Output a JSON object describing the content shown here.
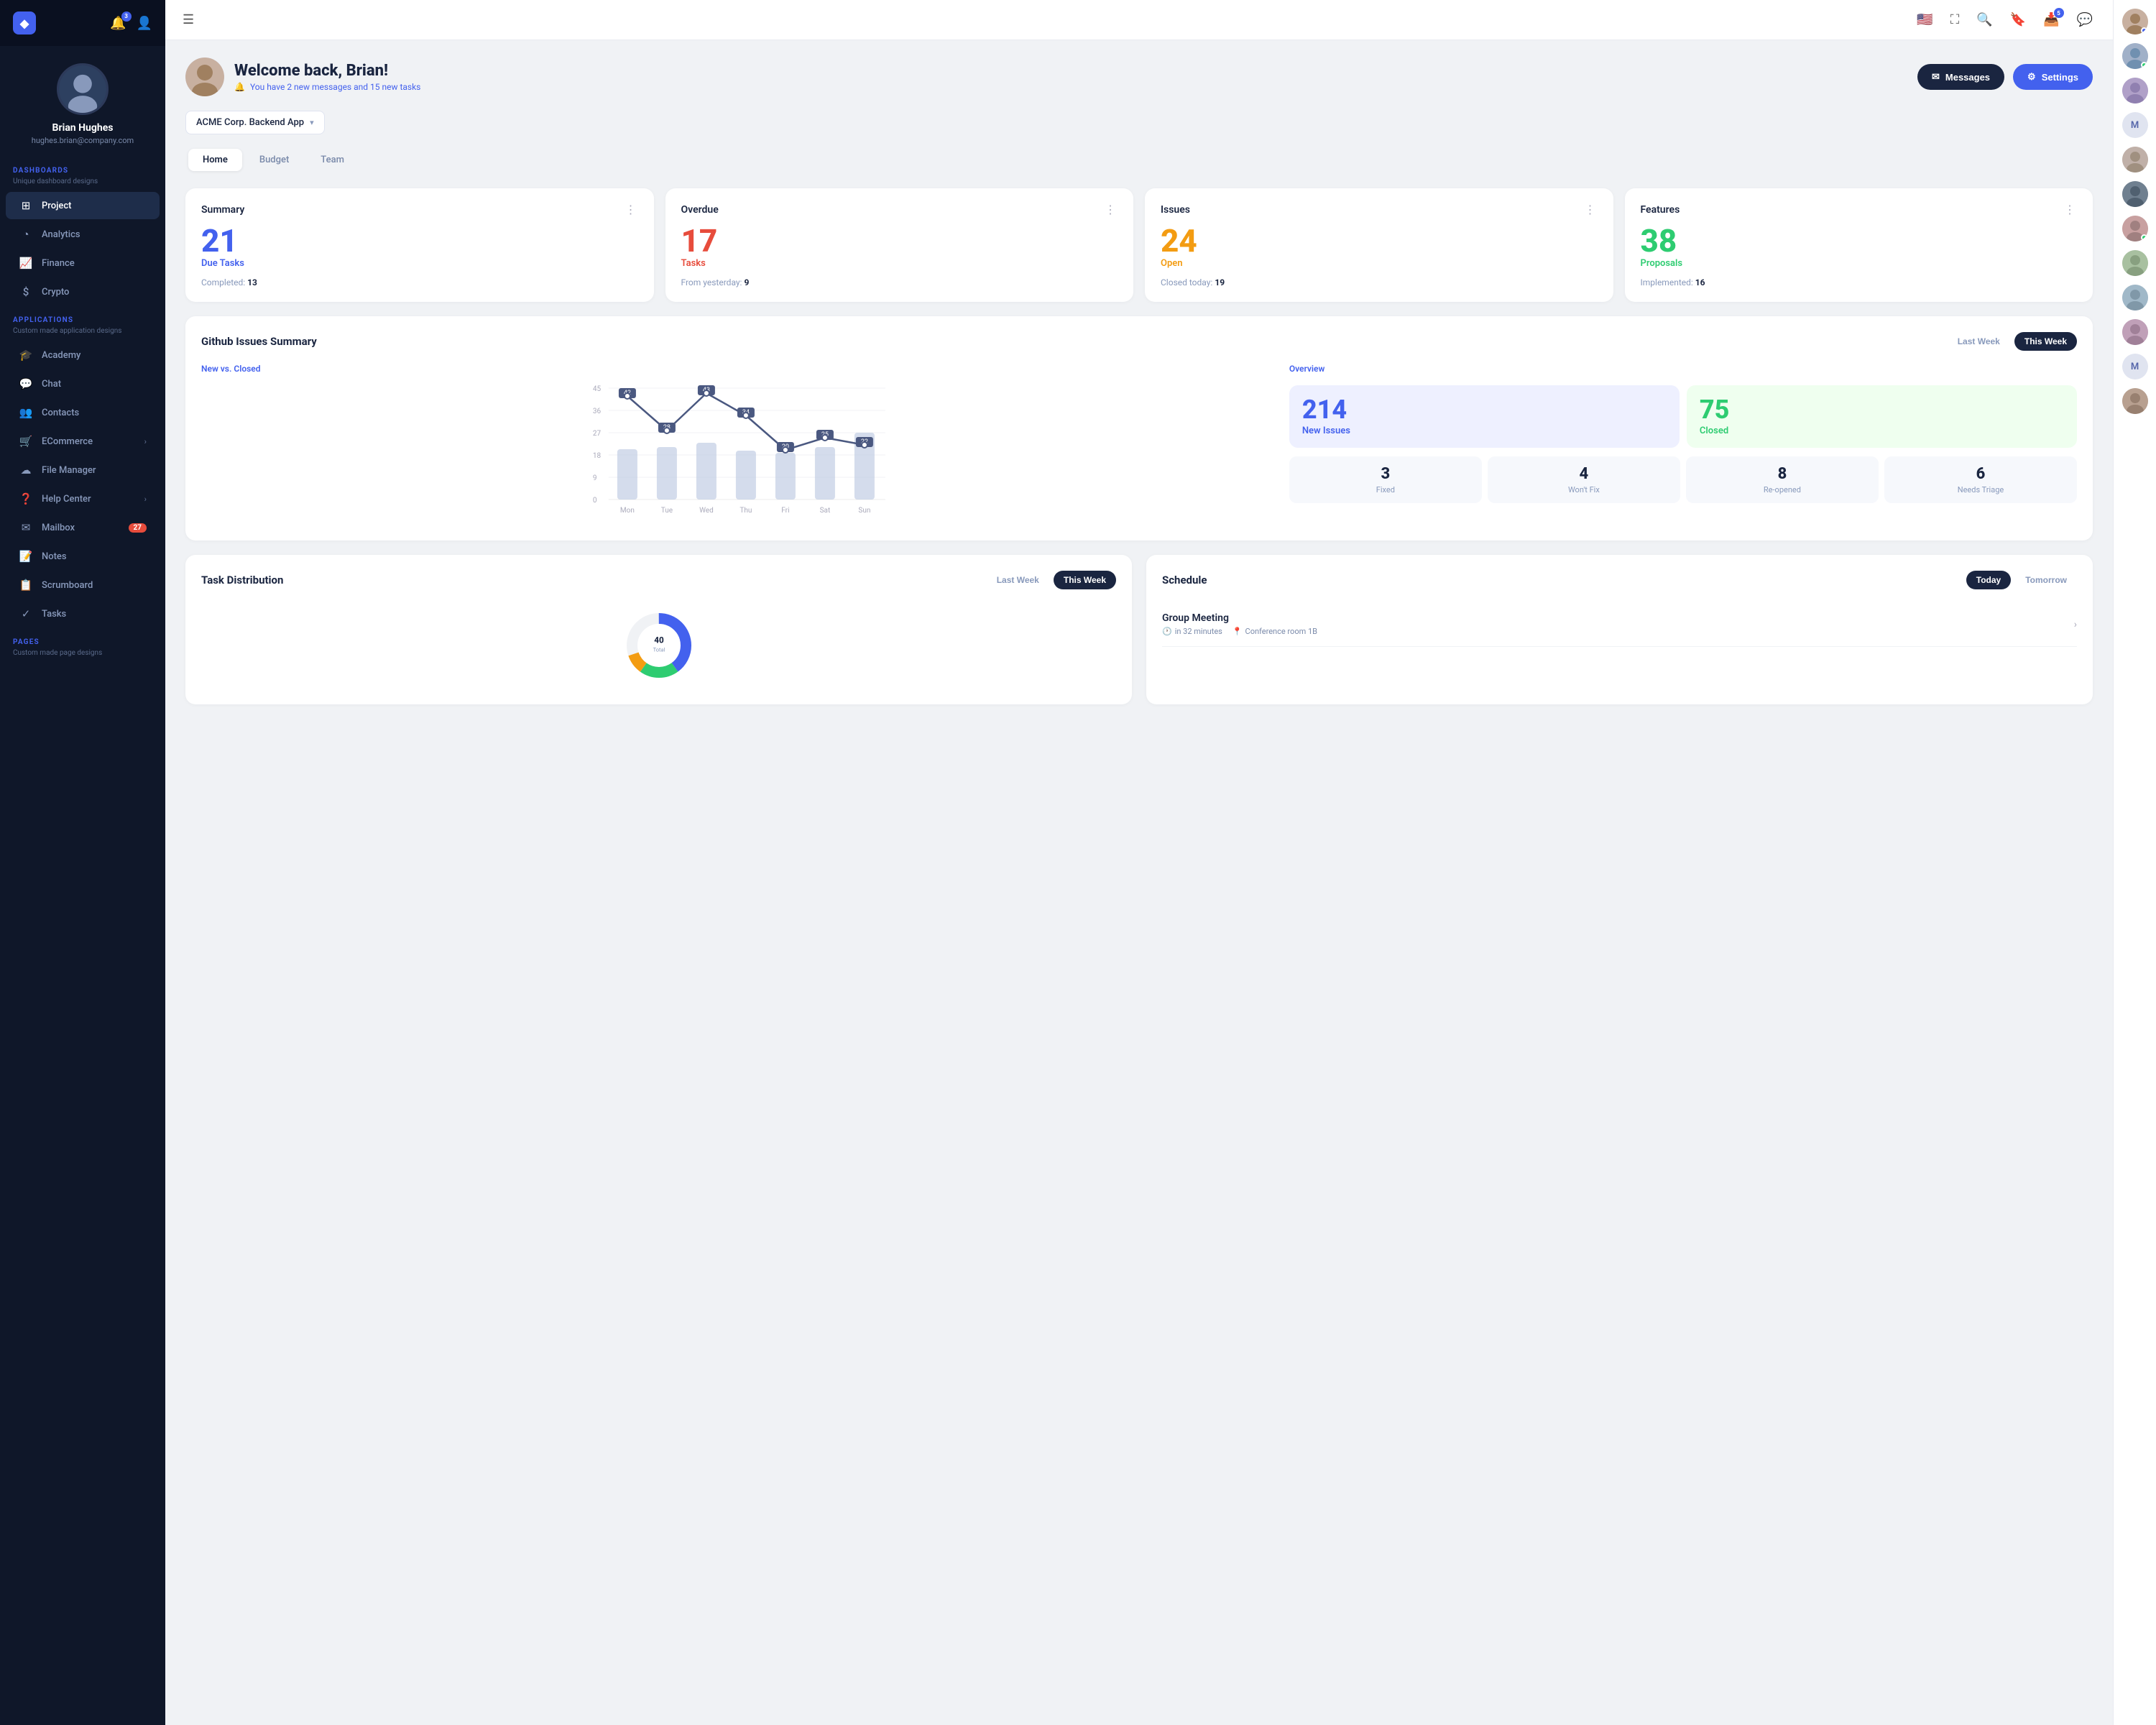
{
  "app": {
    "logo": "◆",
    "notifications_count": "3"
  },
  "sidebar": {
    "profile": {
      "name": "Brian Hughes",
      "email": "hughes.brian@company.com"
    },
    "dashboards_label": "DASHBOARDS",
    "dashboards_sub": "Unique dashboard designs",
    "applications_label": "APPLICATIONS",
    "applications_sub": "Custom made application designs",
    "pages_label": "PAGES",
    "pages_sub": "Custom made page designs",
    "items": [
      {
        "id": "project",
        "label": "Project",
        "icon": "🗂",
        "active": true
      },
      {
        "id": "analytics",
        "label": "Analytics",
        "icon": "📊"
      },
      {
        "id": "finance",
        "label": "Finance",
        "icon": "📈"
      },
      {
        "id": "crypto",
        "label": "Crypto",
        "icon": "💰"
      },
      {
        "id": "academy",
        "label": "Academy",
        "icon": "🎓"
      },
      {
        "id": "chat",
        "label": "Chat",
        "icon": "💬"
      },
      {
        "id": "contacts",
        "label": "Contacts",
        "icon": "👥"
      },
      {
        "id": "ecommerce",
        "label": "ECommerce",
        "icon": "🛒",
        "arrow": "›"
      },
      {
        "id": "file-manager",
        "label": "File Manager",
        "icon": "☁"
      },
      {
        "id": "help-center",
        "label": "Help Center",
        "icon": "❓",
        "arrow": "›"
      },
      {
        "id": "mailbox",
        "label": "Mailbox",
        "icon": "✉",
        "badge": "27"
      },
      {
        "id": "notes",
        "label": "Notes",
        "icon": "📝"
      },
      {
        "id": "scrumboard",
        "label": "Scrumboard",
        "icon": "📋"
      },
      {
        "id": "tasks",
        "label": "Tasks",
        "icon": "✓"
      }
    ]
  },
  "topbar": {
    "inbox_count": "5"
  },
  "welcome": {
    "title": "Welcome back, Brian!",
    "subtitle": "You have 2 new messages and 15 new tasks",
    "messages_btn": "Messages",
    "settings_btn": "Settings"
  },
  "project_selector": {
    "label": "ACME Corp. Backend App"
  },
  "tabs": [
    {
      "id": "home",
      "label": "Home",
      "active": true
    },
    {
      "id": "budget",
      "label": "Budget"
    },
    {
      "id": "team",
      "label": "Team"
    }
  ],
  "summary_cards": [
    {
      "title": "Summary",
      "number": "21",
      "number_color": "blue",
      "label": "Due Tasks",
      "sub_prefix": "Completed:",
      "sub_value": "13"
    },
    {
      "title": "Overdue",
      "number": "17",
      "number_color": "red",
      "label": "Tasks",
      "sub_prefix": "From yesterday:",
      "sub_value": "9"
    },
    {
      "title": "Issues",
      "number": "24",
      "number_color": "orange",
      "label": "Open",
      "sub_prefix": "Closed today:",
      "sub_value": "19"
    },
    {
      "title": "Features",
      "number": "38",
      "number_color": "green",
      "label": "Proposals",
      "sub_prefix": "Implemented:",
      "sub_value": "16"
    }
  ],
  "github": {
    "title": "Github Issues Summary",
    "last_week_btn": "Last Week",
    "this_week_btn": "This Week",
    "chart_label": "New vs. Closed",
    "overview_label": "Overview",
    "days": [
      "Mon",
      "Tue",
      "Wed",
      "Thu",
      "Fri",
      "Sat",
      "Sun"
    ],
    "line_values": [
      42,
      28,
      43,
      34,
      20,
      25,
      22
    ],
    "bar_heights": [
      70,
      65,
      80,
      60,
      55,
      65,
      90
    ],
    "new_issues": "214",
    "new_issues_label": "New Issues",
    "closed": "75",
    "closed_label": "Closed",
    "mini_stats": [
      {
        "num": "3",
        "label": "Fixed"
      },
      {
        "num": "4",
        "label": "Won't Fix"
      },
      {
        "num": "8",
        "label": "Re-opened"
      },
      {
        "num": "6",
        "label": "Needs Triage"
      }
    ]
  },
  "task_dist": {
    "title": "Task Distribution",
    "last_week_btn": "Last Week",
    "this_week_btn": "This Week"
  },
  "schedule": {
    "title": "Schedule",
    "today_btn": "Today",
    "tomorrow_btn": "Tomorrow",
    "events": [
      {
        "title": "Group Meeting",
        "time": "in 32 minutes",
        "location": "Conference room 1B"
      }
    ]
  },
  "right_panel": {
    "avatars": [
      {
        "type": "avatar",
        "initials": "",
        "bg": "#c8b0a0",
        "dot": "blue"
      },
      {
        "type": "avatar",
        "initials": "",
        "bg": "#a0b0c8",
        "dot": "online"
      },
      {
        "type": "avatar",
        "initials": "",
        "bg": "#b0a0c8",
        "dot": ""
      },
      {
        "type": "initial",
        "initials": "M",
        "bg": "#e0e4f0"
      },
      {
        "type": "avatar",
        "initials": "",
        "bg": "#c0b0a8",
        "dot": ""
      },
      {
        "type": "avatar",
        "initials": "",
        "bg": "#708090",
        "dot": ""
      },
      {
        "type": "avatar",
        "initials": "",
        "bg": "#c8a0a0",
        "dot": "online"
      },
      {
        "type": "avatar",
        "initials": "",
        "bg": "#a8c0a0",
        "dot": ""
      },
      {
        "type": "avatar",
        "initials": "",
        "bg": "#a0b8c8",
        "dot": ""
      },
      {
        "type": "avatar",
        "initials": "",
        "bg": "#c0a0b8",
        "dot": ""
      },
      {
        "type": "initial",
        "initials": "M",
        "bg": "#e0e4f0"
      },
      {
        "type": "avatar",
        "initials": "",
        "bg": "#b8a090",
        "dot": ""
      }
    ]
  }
}
